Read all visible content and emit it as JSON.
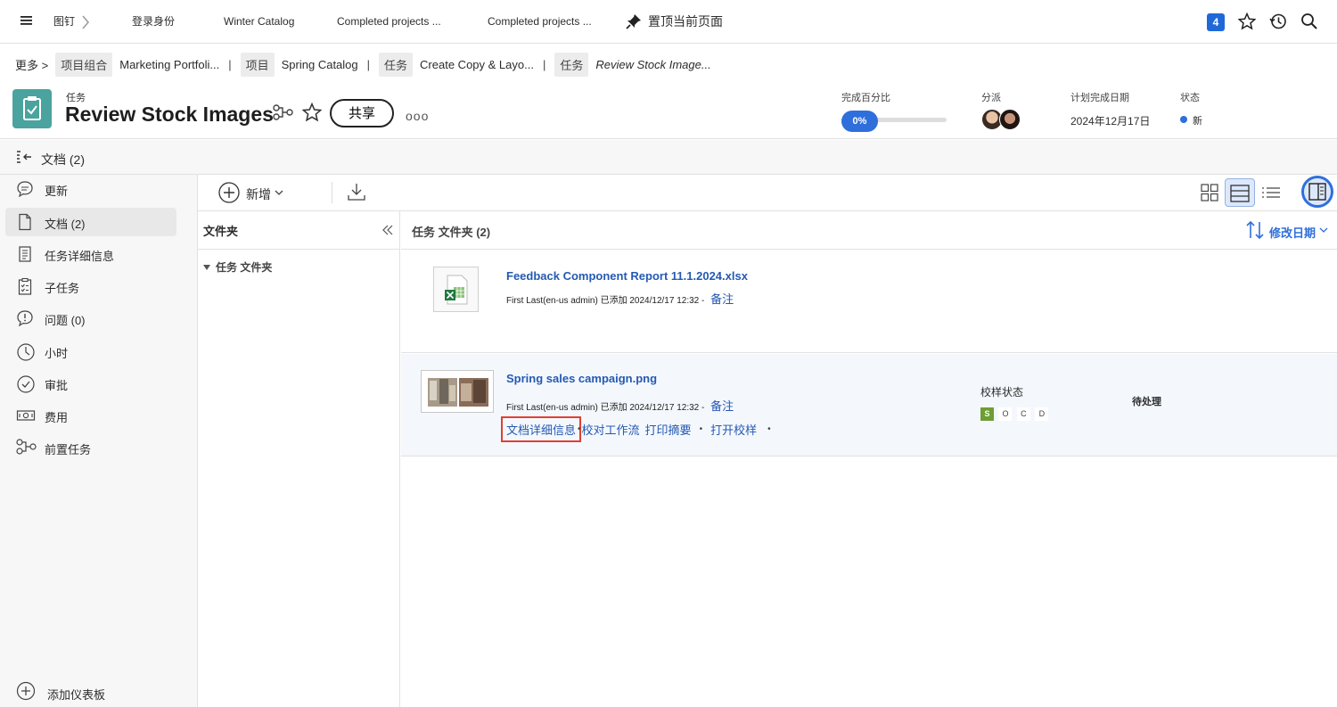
{
  "topnav": {
    "pin_tab": "图钉",
    "login_tab": "登录身份",
    "tab3": "Winter Catalog",
    "tab4": "Completed projects ...",
    "tab5": "Completed projects ...",
    "pin_page": "置顶当前页面",
    "notif_count": "4"
  },
  "breadcrumb": {
    "more": "更多 >",
    "items": [
      {
        "tag": "项目组合",
        "text": "Marketing Portfoli..."
      },
      {
        "tag": "项目",
        "text": "Spring Catalog"
      },
      {
        "tag": "任务",
        "text": "Create Copy & Layo..."
      },
      {
        "tag": "任务",
        "text": "Review Stock Image..."
      }
    ]
  },
  "header": {
    "type": "任务",
    "title": "Review Stock Images",
    "share": "共享",
    "more": "ooo",
    "percent_label": "完成百分比",
    "percent_value": "0%",
    "percent_fraction": 0,
    "assign_label": "分派",
    "date_label": "计划完成日期",
    "date_value": "2024年12月17日",
    "status_label": "状态",
    "status_value": "新",
    "status_color": "#2f6fdb"
  },
  "docs_strip": {
    "title": "文档 (2)"
  },
  "leftnav": {
    "items": [
      {
        "label": "更新",
        "icon": "comment-icon"
      },
      {
        "label": "文档 (2)",
        "icon": "document-icon"
      },
      {
        "label": "任务详细信息",
        "icon": "details-icon"
      },
      {
        "label": "子任务",
        "icon": "clipboard-icon"
      },
      {
        "label": "问题 (0)",
        "icon": "issue-icon"
      },
      {
        "label": "小时",
        "icon": "clock-icon"
      },
      {
        "label": "审批",
        "icon": "check-circle-icon"
      },
      {
        "label": "费用",
        "icon": "money-icon"
      },
      {
        "label": "前置任务",
        "icon": "predecessor-icon"
      }
    ],
    "add_dashboard": "添加仪表板"
  },
  "toolbar": {
    "new_label": "新增"
  },
  "folders": {
    "title": "文件夹",
    "node": "任务 文件夹"
  },
  "list": {
    "title": "任务 文件夹 (2)",
    "sort_label": "修改日期",
    "rows": [
      {
        "name": "Feedback Component Report 11.1.2024.xlsx",
        "meta": "First Last(en-us admin) 已添加 2024/12/17 12:32 -",
        "note": "备注"
      },
      {
        "name": "Spring sales campaign.png",
        "meta": "First Last(en-us admin) 已添加 2024/12/17 12:32 -",
        "note": "备注",
        "actions": [
          "文档详细信息",
          "校对工作流",
          "打印摘要",
          "打开校样"
        ],
        "proof_label": "校样状态",
        "proof_badges": [
          "S",
          "O",
          "C",
          "D"
        ],
        "proof_status": "待处理"
      }
    ]
  }
}
